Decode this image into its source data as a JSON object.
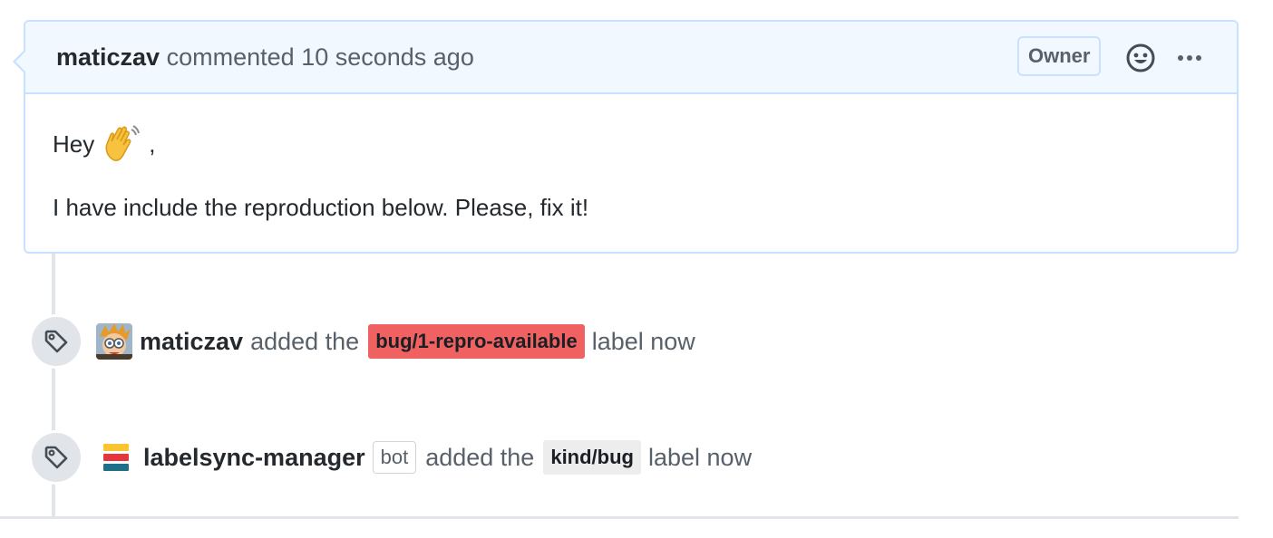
{
  "comment": {
    "author": "maticzav",
    "action_text": "commented",
    "timestamp": "10 seconds ago",
    "badge": "Owner",
    "reaction_icon": "smiley-icon",
    "more_icon": "kebab-horizontal-icon",
    "body": {
      "greeting": "Hey",
      "greeting_emoji": "waving-hand",
      "greeting_suffix": ",",
      "paragraph": "I have include the reproduction below. Please, fix it!"
    }
  },
  "events": [
    {
      "icon": "tag-icon",
      "actor": "maticzav",
      "action": "added the",
      "label": {
        "name": "bug/1-repro-available",
        "color": "#f06262",
        "text_color": "#1b1f23"
      },
      "suffix": "label now"
    },
    {
      "icon": "tag-icon",
      "actor": "labelsync-manager",
      "bot_badge": "bot",
      "action": "added the",
      "label": {
        "name": "kind/bug",
        "color": "#ededed",
        "text_color": "#1b1f23"
      },
      "suffix": "label now"
    }
  ],
  "colors": {
    "header_bg": "#f1f8ff",
    "header_border": "#c8e1ff",
    "timeline": "#e1e4e8"
  }
}
